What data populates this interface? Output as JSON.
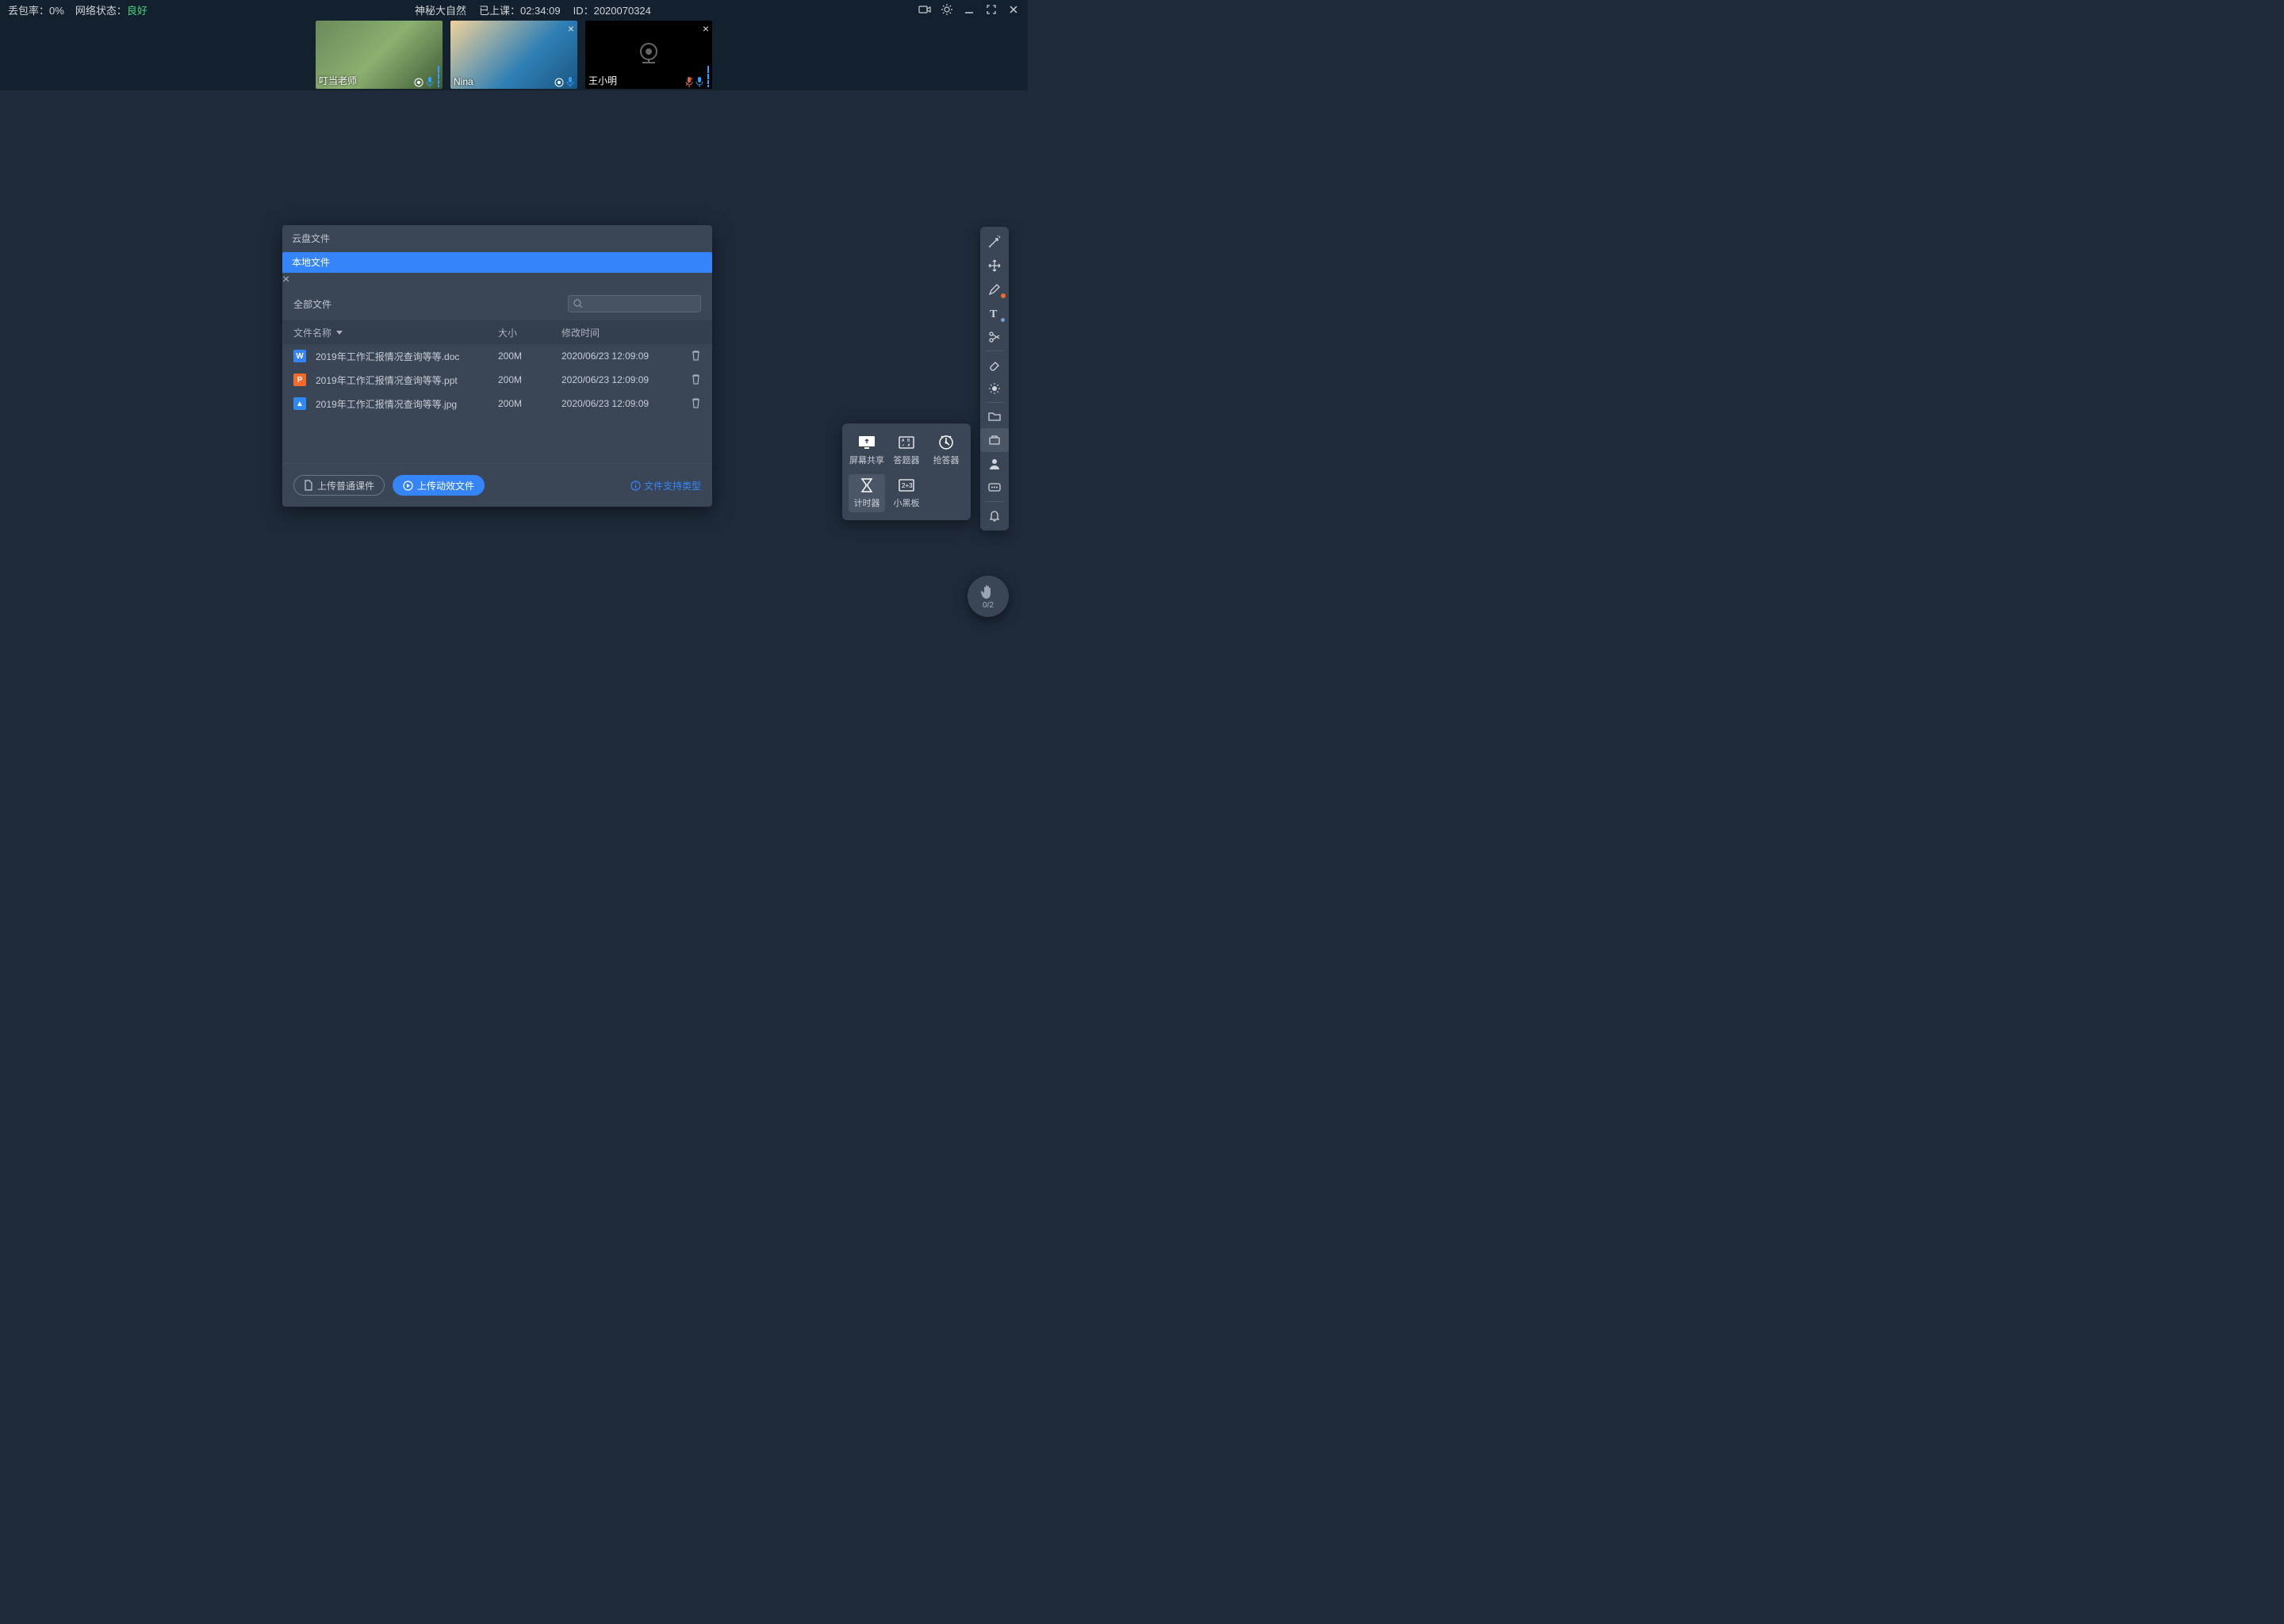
{
  "topbar": {
    "packet_loss_label": "丢包率：",
    "packet_loss_value": "0%",
    "net_status_label": "网络状态：",
    "net_status_value": "良好",
    "title": "神秘大自然",
    "elapsed_label": "已上课：",
    "elapsed_value": "02:34:09",
    "room_id_label": "ID：",
    "room_id_value": "2020070324"
  },
  "participants": [
    {
      "name": "叮当老师",
      "camera": "on",
      "closeable": false
    },
    {
      "name": "Nina",
      "camera": "on",
      "closeable": true
    },
    {
      "name": "王小明",
      "camera": "off",
      "closeable": true
    }
  ],
  "modal": {
    "tab_cloud": "云盘文件",
    "tab_local": "本地文件",
    "all_files": "全部文件",
    "search_placeholder": "",
    "col_name": "文件名称",
    "col_size": "大小",
    "col_time": "修改时间",
    "files": [
      {
        "icon": "W",
        "name": "2019年工作汇报情况查询等等.doc",
        "size": "200M",
        "time": "2020/06/23 12:09:09"
      },
      {
        "icon": "P",
        "name": "2019年工作汇报情况查询等等.ppt",
        "size": "200M",
        "time": "2020/06/23 12:09:09"
      },
      {
        "icon": "▲",
        "name": "2019年工作汇报情况查询等等.jpg",
        "size": "200M",
        "time": "2020/06/23 12:09:09"
      }
    ],
    "upload_normal": "上传普通课件",
    "upload_dynamic": "上传动效文件",
    "support_link": "文件支持类型"
  },
  "tools_popup": {
    "screen_share": "屏幕共享",
    "answer": "答题器",
    "buzzer": "抢答器",
    "timer": "计时器",
    "blackboard": "小黑板"
  },
  "hand_fab": {
    "count": "0/2"
  }
}
